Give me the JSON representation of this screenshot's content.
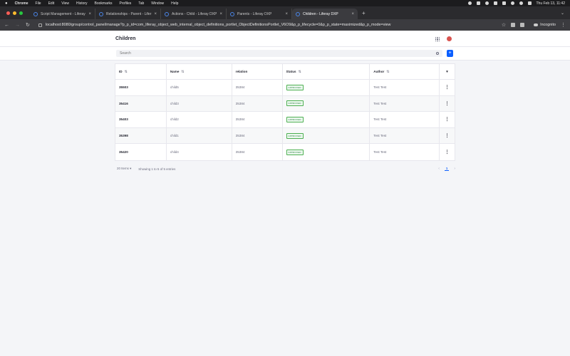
{
  "menubar": {
    "items": [
      "Chrome",
      "File",
      "Edit",
      "View",
      "History",
      "Bookmarks",
      "Profiles",
      "Tab",
      "Window",
      "Help"
    ],
    "datetime": "Thu Feb 13, 11:42"
  },
  "tabs": [
    {
      "title": "Script Management - Liferay"
    },
    {
      "title": "Relationships - Parent - Lifer"
    },
    {
      "title": "Actions - Child - Liferay DXP"
    },
    {
      "title": "Parents - Liferay DXP"
    },
    {
      "title": "Children - Liferay DXP"
    }
  ],
  "browser": {
    "url": "localhost:8080/group/control_panel/manage?p_p_id=com_liferay_object_web_internal_object_definitions_portlet_ObjectDefinitionsPortlet_V6O9&p_p_lifecycle=0&p_p_state=maximized&p_p_mode=view",
    "profile": "Incognito"
  },
  "page": {
    "title": "Children",
    "search_placeholder": "Search",
    "add_label": "+"
  },
  "table": {
    "columns": {
      "id": "ID",
      "name": "Name",
      "relation": "relation",
      "status": "Status",
      "author": "Author"
    },
    "rows": [
      {
        "id": "35503",
        "name": "child5",
        "relation": "35384",
        "status": "APPROVED",
        "author": "Test Test"
      },
      {
        "id": "35416",
        "name": "child3",
        "relation": "35384",
        "status": "APPROVED",
        "author": "Test Test"
      },
      {
        "id": "35403",
        "name": "child2",
        "relation": "35384",
        "status": "APPROVED",
        "author": "Test Test"
      },
      {
        "id": "35398",
        "name": "child1",
        "relation": "35384",
        "status": "APPROVED",
        "author": "Test Test"
      },
      {
        "id": "35420",
        "name": "child4",
        "relation": "35384",
        "status": "APPROVED",
        "author": "Test Test"
      }
    ]
  },
  "pagination": {
    "items_per_page": "20 Items",
    "summary": "Showing 1 to 5 of 5 entries",
    "current_page": "1"
  },
  "colors": {
    "accent": "#0b5fff",
    "status_green": "#287d3c"
  }
}
